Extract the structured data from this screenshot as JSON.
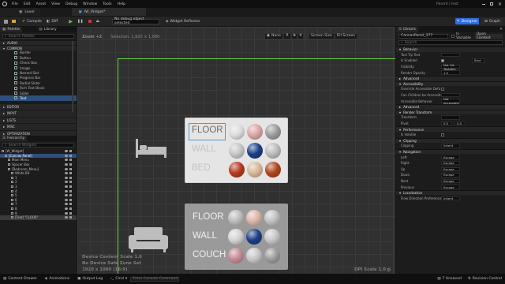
{
  "menu": [
    "File",
    "Edit",
    "Asset",
    "View",
    "Debug",
    "Window",
    "Tools",
    "Help"
  ],
  "project": "Parent | test",
  "doc_tabs": [
    "Level",
    "IW_Widget*"
  ],
  "toolbar": {
    "compile": "Compile",
    "diff": "Diff",
    "debug_object": "No debug object selected",
    "widget_reflector": "Widget Reflector",
    "designer": "Designer",
    "graph": "Graph"
  },
  "palette": {
    "tab": "Palette",
    "library_tab": "Library",
    "search_placeholder": "Search Palette",
    "categories": [
      "AUDIO",
      "COMMON"
    ],
    "common_items": [
      "Border",
      "Button",
      "Check Box",
      "Image",
      "Named Slot",
      "Progress Bar",
      "Radial Slider",
      "Rich Text Block",
      "Slider",
      "Text"
    ],
    "more_categories": [
      "EDITOR",
      "INPUT",
      "LISTS",
      "MISC",
      "OPTIMIZATION"
    ]
  },
  "hierarchy": {
    "tab": "Hierarchy",
    "search_placeholder": "Search Widgets",
    "rows": [
      "[W_Widget]",
      "[Canvas Panel]",
      "Main Menu",
      "Spacer Box",
      "[Bedroom_Menu]",
      "White Bit",
      "1",
      "2",
      "3",
      "4",
      "5",
      "6",
      "7",
      "8",
      "9",
      "[Text] \"FLOOR\""
    ]
  },
  "canvas": {
    "zoom": "Zoom +2",
    "selection": "Selection: 1,920 × 1,080",
    "view_controls": [
      "None",
      "R",
      "Screen Size",
      "Fill Screen"
    ],
    "footer_line1": "Device Content Scale 1.0",
    "footer_line2": "No Device Safe Zone Set",
    "footer_line3": "1920 x 1080 (16:9)",
    "dpi": "DPI Scale 1.0"
  },
  "panel1": {
    "labels": [
      "FLOOR",
      "WALL",
      "BED"
    ],
    "swatches": [
      [
        "#dcdcdc",
        "#d9a7a4",
        "#9c9c9c"
      ],
      [
        "#c6c6c6",
        "#1b3f86",
        "#bcbcbc"
      ],
      [
        "#b43a20",
        "#d8b79a",
        "#b0461c"
      ]
    ]
  },
  "panel2": {
    "labels": [
      "FLOOR",
      "WALL",
      "COUCH"
    ],
    "swatches": [
      [
        "#bdbdbd",
        "#dcb7a7",
        "#c2c2c2"
      ],
      [
        "#d4d4d4",
        "#1b3f86",
        "#c8c8c8"
      ],
      [
        "#c78b96",
        "#c8c8c8",
        "#9c9c9c"
      ]
    ]
  },
  "details": {
    "tab": "Details",
    "name_value": "CanvasPanel_377",
    "is_variable": "Is Variable",
    "open_context": "Open Context",
    "search_placeholder": "Search",
    "sections": [
      {
        "title": "Behavior",
        "rows": [
          {
            "label": "Tool Tip Text",
            "value": ""
          },
          {
            "label": "Is Enabled",
            "value": "Bind"
          },
          {
            "label": "Visibility",
            "value": "Not Hit-Testable"
          },
          {
            "label": "Render Opacity",
            "value": "1.0"
          }
        ]
      },
      {
        "title": "Advanced",
        "rows": []
      },
      {
        "title": "Accessibility",
        "rows": [
          {
            "label": "Override Accessible Defa",
            "value": ""
          },
          {
            "label": "Can Children be Accessible",
            "value": ""
          },
          {
            "label": "Accessible Behavior",
            "value": "Not Accessible"
          }
        ]
      },
      {
        "title": "Advanced",
        "rows": []
      },
      {
        "title": "Render Transform",
        "rows": [
          {
            "label": "Transform",
            "value": ""
          },
          {
            "label": "Pivot",
            "value": "0.5"
          }
        ]
      },
      {
        "title": "Performance",
        "rows": [
          {
            "label": "Is Volatile",
            "value": ""
          }
        ]
      },
      {
        "title": "Clipping",
        "rows": [
          {
            "label": "Clipping",
            "value": "Inherit"
          }
        ]
      },
      {
        "title": "Navigation",
        "rows": [
          {
            "label": "Left",
            "value": "Escape"
          },
          {
            "label": "Right",
            "value": "Escape"
          },
          {
            "label": "Up",
            "value": "Escape"
          },
          {
            "label": "Down",
            "value": "Escape"
          },
          {
            "label": "Next",
            "value": "Escape"
          },
          {
            "label": "Previous",
            "value": "Escape"
          }
        ]
      },
      {
        "title": "Localization",
        "rows": [
          {
            "label": "Flow Direction Preference",
            "value": "Inherit"
          }
        ]
      }
    ],
    "pivot_y": "0.5"
  },
  "status": {
    "tabs": [
      "Content Drawer",
      "Animations",
      "Output Log",
      "Cmd"
    ],
    "console_placeholder": "Enter Console Command",
    "unsaved": "7 Unsaved",
    "revision": "Revision Control"
  }
}
